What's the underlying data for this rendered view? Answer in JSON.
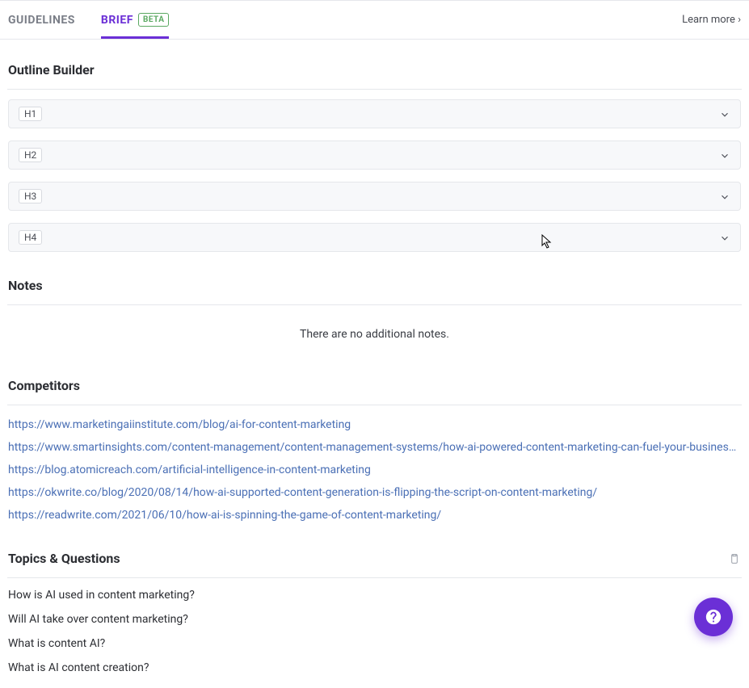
{
  "tabs": {
    "guidelines": "GUIDELINES",
    "brief": "BRIEF",
    "beta_badge": "BETA"
  },
  "learn_more": "Learn more ›",
  "sections": {
    "outline_builder": {
      "title": "Outline Builder",
      "items": [
        {
          "tag": "H1"
        },
        {
          "tag": "H2"
        },
        {
          "tag": "H3"
        },
        {
          "tag": "H4"
        }
      ]
    },
    "notes": {
      "title": "Notes",
      "empty_message": "There are no additional notes."
    },
    "competitors": {
      "title": "Competitors",
      "links": [
        "https://www.marketingaiinstitute.com/blog/ai-for-content-marketing",
        "https://www.smartinsights.com/content-management/content-management-systems/how-ai-powered-content-marketing-can-fuel-your-business-…",
        "https://blog.atomicreach.com/artificial-intelligence-in-content-marketing",
        "https://okwrite.co/blog/2020/08/14/how-ai-supported-content-generation-is-flipping-the-script-on-content-marketing/",
        "https://readwrite.com/2021/06/10/how-ai-is-spinning-the-game-of-content-marketing/"
      ]
    },
    "topics_questions": {
      "title": "Topics & Questions",
      "items": [
        "How is AI used in content marketing?",
        "Will AI take over content marketing?",
        "What is content AI?",
        "What is AI content creation?"
      ]
    }
  }
}
